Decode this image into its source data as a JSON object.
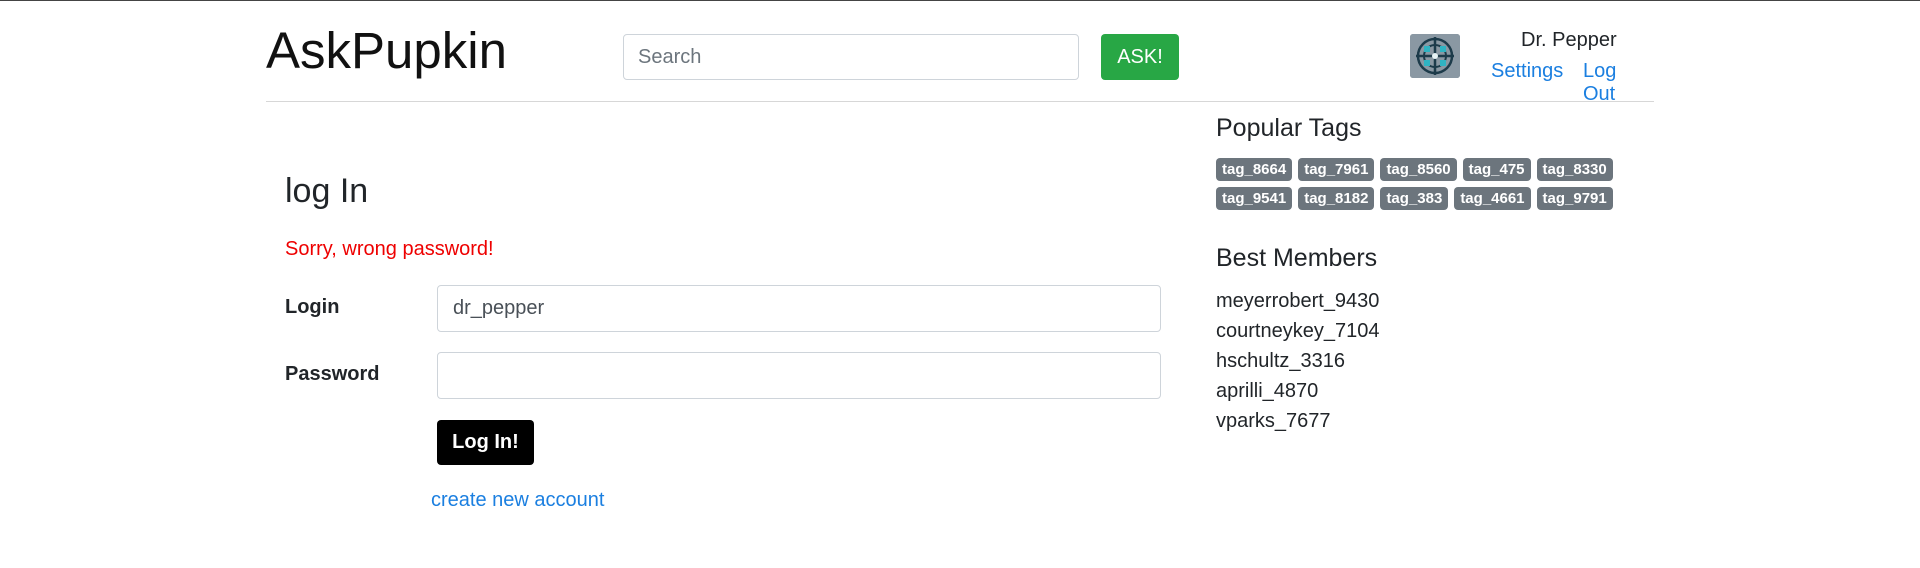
{
  "header": {
    "brand": "AskPupkin",
    "search_placeholder": "Search",
    "ask_label": "ASK!",
    "user_name": "Dr. Pepper",
    "avatar_icon": "avatar-icon",
    "settings_label": "Settings",
    "logout_label": "Log Out"
  },
  "login": {
    "title": "log In",
    "error": "Sorry, wrong password!",
    "login_label": "Login",
    "login_value": "dr_pepper",
    "password_label": "Password",
    "password_value": "",
    "submit_label": "Log In!",
    "create_account_label": "create new account"
  },
  "sidebar": {
    "tags_title": "Popular Tags",
    "tags": [
      [
        "tag_8664",
        "tag_7961",
        "tag_8560",
        "tag_475",
        "tag_8330"
      ],
      [
        "tag_9541",
        "tag_8182",
        "tag_383",
        "tag_4661",
        "tag_9791"
      ]
    ],
    "members_title": "Best Members",
    "members": [
      "meyerrobert_9430",
      "courtneykey_7104",
      "hschultz_3316",
      "aprilli_4870",
      "vparks_7677"
    ]
  },
  "colors": {
    "ask_button": "#28a745",
    "link": "#1b7fe0",
    "error": "#ee0000",
    "tag_badge": "#6c757d",
    "login_button": "#000000"
  }
}
